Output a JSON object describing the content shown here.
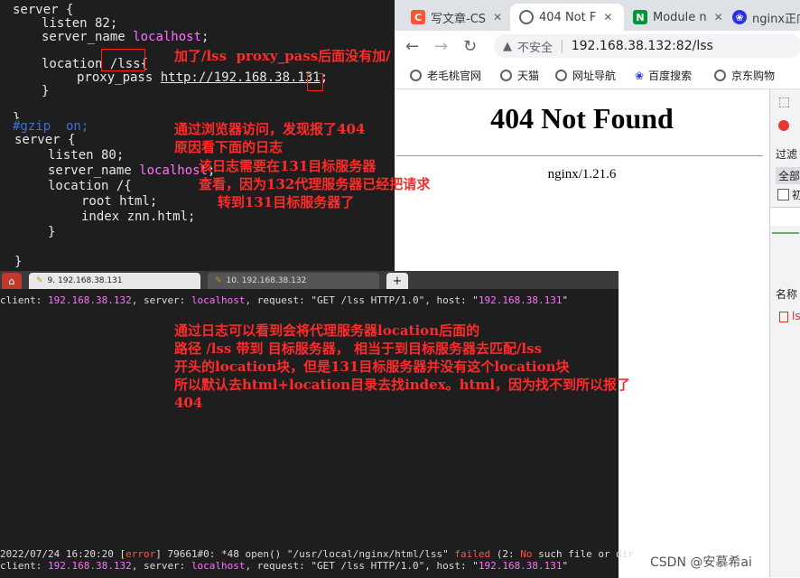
{
  "editor_top": {
    "lines": [
      "server {",
      "listen 82;",
      "server_name ",
      "localhost",
      ";",
      "location ",
      "/lss{",
      "proxy_pass ",
      "http://192.168.38.131",
      ";",
      "}",
      "}"
    ]
  },
  "editor_bottom": {
    "comment": "#gzip  on;",
    "lines": [
      "server {",
      "listen 80;",
      "server_name ",
      "localhost",
      ";",
      "location /{",
      "root html;",
      "index znn.html;",
      "}",
      "}"
    ]
  },
  "annotations": {
    "note1": "加了/lss  proxy_pass后面没有加/",
    "note2": "通过浏览器访问，发现报了404\n原因看下面的日志",
    "note3": "该日志需要在131目标服务器\n查看，因为132代理服务器已经把请求\n    转到131目标服务器了",
    "note4": "通过日志可以看到会将代理服务器location后面的\n路径 /lss 带到 目标服务器， 相当于到目标服务器去匹配/lss\n开头的location块，但是131目标服务器并没有这个location块\n所以默认去html+location目录去找index。html，因为找不到所以报了\n404"
  },
  "browser": {
    "tabs": [
      {
        "label": "写文章-CS",
        "icon": "csdn-icon"
      },
      {
        "label": "404 Not F",
        "icon": "globe-icon"
      },
      {
        "label": "Module n",
        "icon": "nginx-icon"
      },
      {
        "label": "nginx正向",
        "icon": "baidu-icon"
      }
    ],
    "security": "不安全",
    "url": "192.168.38.132:82/lss",
    "bookmarks": [
      "老毛桃官网",
      "天猫",
      "网址导航",
      "百度搜索",
      "京东购物"
    ],
    "page_title": "404 Not Found",
    "page_footer": "nginx/1.21.6"
  },
  "devtools": {
    "filter": "过滤",
    "all": "全部",
    "hide_char": "初",
    "name_col": "名称",
    "item": "ls"
  },
  "terminal": {
    "tabs": [
      "9. 192.168.38.131",
      "10. 192.168.38.132"
    ],
    "line1": {
      "a": "client: ",
      "b": "192.168.38.132",
      "c": ", server: ",
      "d": "localhost",
      "e": ", request: \"GET /lss HTTP/1.0\", host: \"",
      "f": "192.168.38.131",
      "g": "\""
    },
    "line2": {
      "a": "2022/07/24 16:20:20 [",
      "b": "error",
      "c": "] 79661#0: *48 open() \"/usr/local/nginx/html/lss\" ",
      "d": "failed",
      "e": " (2: ",
      "f": "No",
      "g": " such file or dir"
    },
    "line3": {
      "a": "client: ",
      "b": "192.168.38.132",
      "c": ", server: ",
      "d": "localhost",
      "e": ", request: \"GET /lss HTTP/1.0\", host: \"",
      "f": "192.168.38.131",
      "g": "\""
    }
  },
  "watermark": "CSDN @安慕希ai",
  "colors": {
    "annotation": "#ff2a2a",
    "keyword": "#ff70ff",
    "terminal_bg": "#1e1e1e"
  }
}
